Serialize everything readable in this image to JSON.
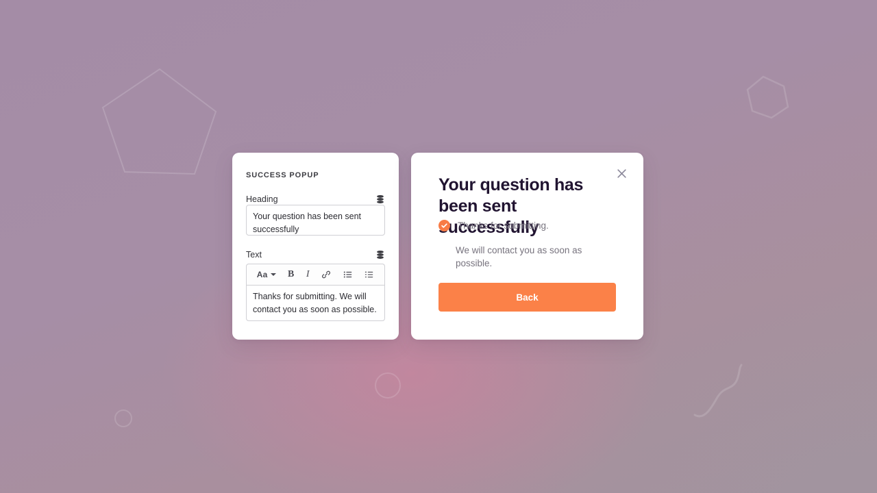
{
  "background": {
    "gradient_top": "#a48ca6",
    "gradient_accent": "#d6809e",
    "shapes": [
      {
        "name": "pentagon-outline"
      },
      {
        "name": "hexagon-outline"
      },
      {
        "name": "circle-outline-large"
      },
      {
        "name": "circle-outline-small"
      },
      {
        "name": "squiggle-line"
      }
    ]
  },
  "editor": {
    "panel_title": "SUCCESS POPUP",
    "heading_field": {
      "label": "Heading",
      "value": "Your question has been sent successfully",
      "icon": "database-icon"
    },
    "text_field": {
      "label": "Text",
      "value": "Thanks for submitting. We will contact you as soon as possible.",
      "icon": "database-icon"
    },
    "toolbar": [
      {
        "name": "font-size-dropdown",
        "label": "Aa",
        "icon": "chevron-down-icon"
      },
      {
        "name": "bold-button",
        "label": "B",
        "icon": "bold-icon"
      },
      {
        "name": "italic-button",
        "label": "I",
        "icon": "italic-icon"
      },
      {
        "name": "link-button",
        "label": "",
        "icon": "link-icon"
      },
      {
        "name": "bullet-list-button",
        "label": "",
        "icon": "bullet-list-icon"
      },
      {
        "name": "ordered-list-button",
        "label": "",
        "icon": "ordered-list-icon"
      }
    ]
  },
  "preview": {
    "close_icon": "close-icon",
    "heading": "Your question has been sent successfully",
    "confirmation": "Thanks for submitting.",
    "check_icon": "check-circle-icon",
    "body": "We will contact you as soon as possible.",
    "back_label": "Back",
    "accent_color": "#fb8148",
    "heading_color": "#211431",
    "muted_text_color": "#77737e"
  }
}
